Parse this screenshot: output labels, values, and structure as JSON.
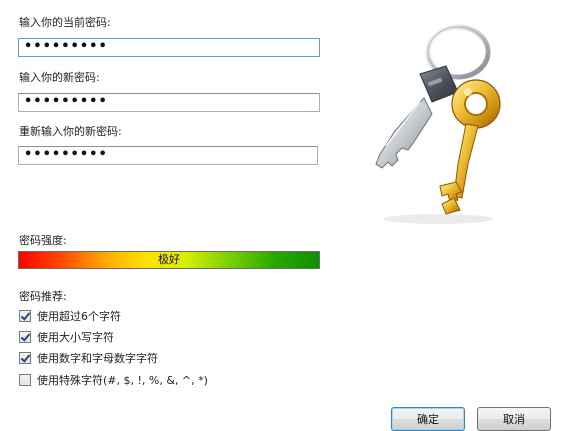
{
  "form": {
    "current_password_label": "输入你的当前密码:",
    "current_password_value": "•••••••••",
    "new_password_label": "输入你的新密码:",
    "new_password_value": "•••••••••",
    "confirm_password_label": "重新输入你的新密码:",
    "confirm_password_value": "•••••••••"
  },
  "strength": {
    "label": "密码强度:",
    "value_text": "极好"
  },
  "recommendations": {
    "label": "密码推荐:",
    "items": [
      {
        "label": "使用超过6个字符",
        "checked": true
      },
      {
        "label": "使用大小写字符",
        "checked": true
      },
      {
        "label": "使用数字和字母数字字符",
        "checked": true
      },
      {
        "label": "使用特殊字符(#, $, !, %, &, ^, *)",
        "checked": false
      }
    ]
  },
  "buttons": {
    "ok": "确定",
    "cancel": "取消"
  },
  "illustration": {
    "icon": "keys-icon"
  }
}
